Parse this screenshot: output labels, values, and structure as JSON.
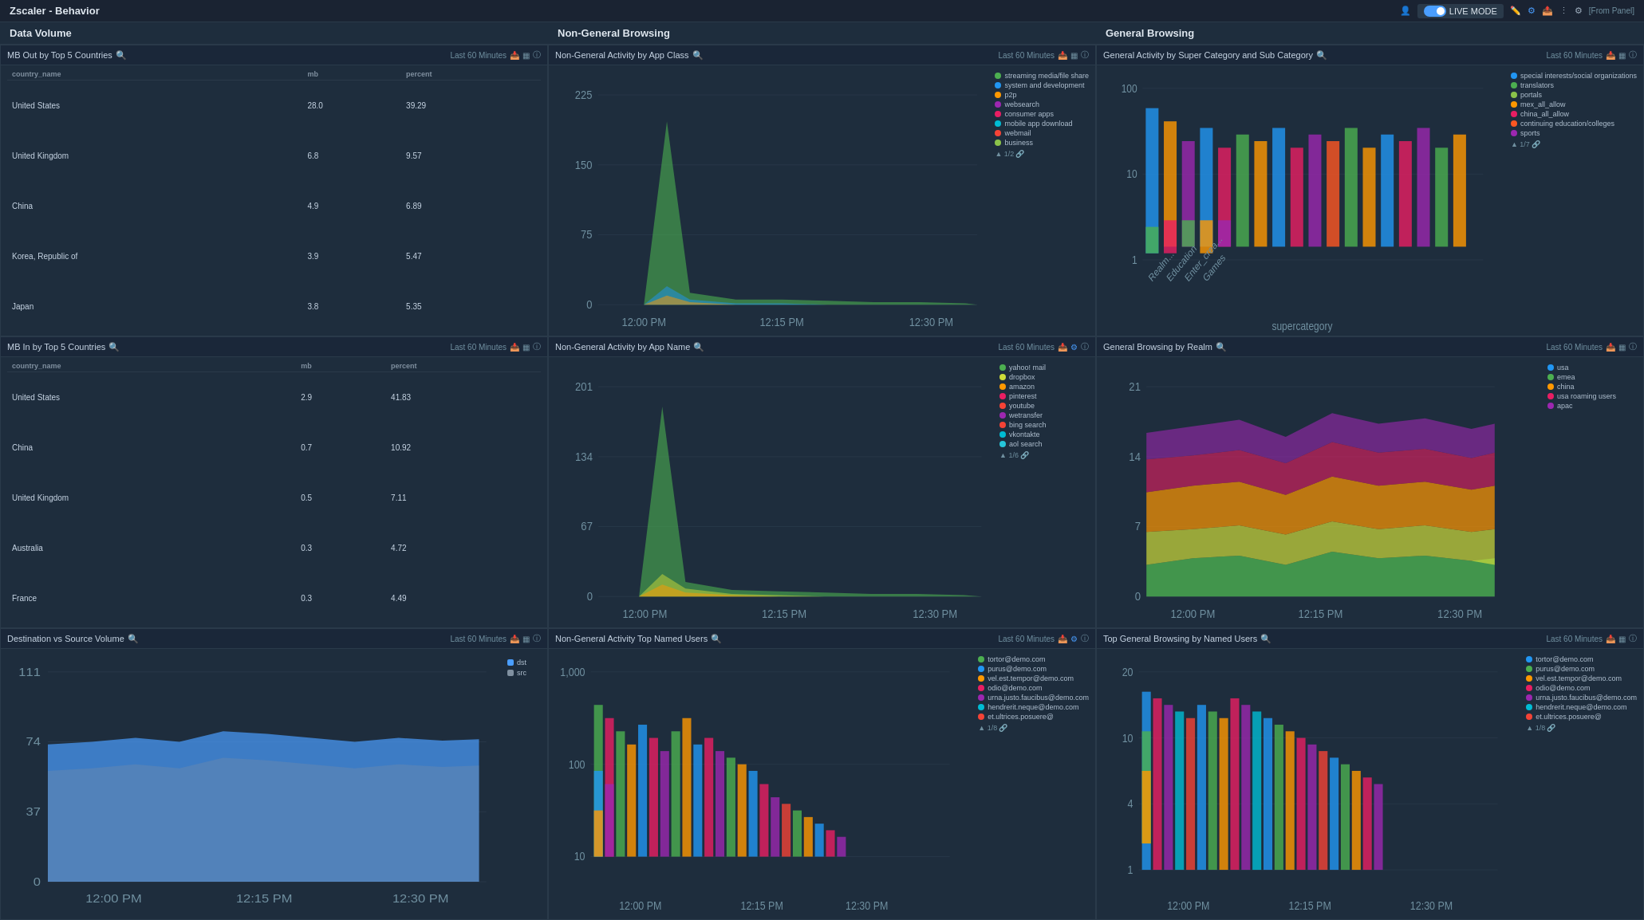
{
  "app": {
    "title": "Zscaler - Behavior",
    "live_mode": "LIVE MODE",
    "from_panel": "[From Panel]"
  },
  "sections": {
    "data_volume": "Data Volume",
    "non_general": "Non-General Browsing",
    "general": "General Browsing"
  },
  "panels": {
    "mb_out": {
      "title": "MB Out by Top 5 Countries",
      "time": "Last 60 Minutes",
      "columns": [
        "country_name",
        "mb",
        "percent"
      ],
      "rows": [
        [
          "United States",
          "28.0",
          "39.29"
        ],
        [
          "United Kingdom",
          "6.8",
          "9.57"
        ],
        [
          "China",
          "4.9",
          "6.89"
        ],
        [
          "Korea, Republic of",
          "3.9",
          "5.47"
        ],
        [
          "Japan",
          "3.8",
          "5.35"
        ]
      ]
    },
    "mb_in": {
      "title": "MB In by Top 5 Countries",
      "time": "Last 60 Minutes",
      "columns": [
        "country_name",
        "mb",
        "percent"
      ],
      "rows": [
        [
          "United States",
          "2.9",
          "41.83"
        ],
        [
          "China",
          "0.7",
          "10.92"
        ],
        [
          "United Kingdom",
          "0.5",
          "7.11"
        ],
        [
          "Australia",
          "0.3",
          "4.72"
        ],
        [
          "France",
          "0.3",
          "4.49"
        ]
      ]
    },
    "dst_src": {
      "title": "Destination vs Source Volume",
      "time": "Last 60 Minutes",
      "y_max": "111",
      "y_mid": "74",
      "y_low": "37",
      "y_zero": "0",
      "legend": [
        "dst",
        "src"
      ],
      "times": [
        "12:00 PM",
        "12:15 PM",
        "12:30 PM"
      ]
    },
    "app_class": {
      "title": "Non-General Activity by App Class",
      "time": "Last 60 Minutes",
      "y_max": "225",
      "y_mid": "150",
      "y_low": "75",
      "y_zero": "0",
      "times": [
        "12:00 PM",
        "12:15 PM",
        "12:30 PM"
      ],
      "legend": [
        {
          "label": "streaming media/file share",
          "color": "#4caf50"
        },
        {
          "label": "system and development",
          "color": "#2196f3"
        },
        {
          "label": "p2p",
          "color": "#ff9800"
        },
        {
          "label": "websearch",
          "color": "#9c27b0"
        },
        {
          "label": "consumer apps",
          "color": "#e91e63"
        },
        {
          "label": "mobile app download",
          "color": "#00bcd4"
        },
        {
          "label": "webmail",
          "color": "#f44336"
        },
        {
          "label": "business",
          "color": "#8bc34a"
        }
      ],
      "page": "1/2"
    },
    "app_name": {
      "title": "Non-General Activity by App Name",
      "time": "Last 60 Minutes",
      "y_max": "201",
      "y_mid": "134",
      "y_low": "67",
      "y_zero": "0",
      "times": [
        "12:00 PM",
        "12:15 PM",
        "12:30 PM"
      ],
      "legend": [
        {
          "label": "yahoo! mail",
          "color": "#4caf50"
        },
        {
          "label": "dropbox",
          "color": "#cddc39"
        },
        {
          "label": "amazon",
          "color": "#ff9800"
        },
        {
          "label": "pinterest",
          "color": "#e91e63"
        },
        {
          "label": "youtube",
          "color": "#f44336"
        },
        {
          "label": "wetransfer",
          "color": "#9c27b0"
        },
        {
          "label": "bing search",
          "color": "#f44336"
        },
        {
          "label": "vkontakte",
          "color": "#00bcd4"
        },
        {
          "label": "aol search",
          "color": "#26c6da"
        }
      ],
      "page": "1/6"
    },
    "top_users_non": {
      "title": "Non-General Activity Top Named Users",
      "time": "Last 60 Minutes",
      "y_max": "1,000",
      "y_mid": "100",
      "y_low": "10",
      "times": [
        "12:00 PM",
        "12:15 PM",
        "12:30 PM"
      ],
      "legend": [
        {
          "label": "tortor@demo.com",
          "color": "#4caf50"
        },
        {
          "label": "purus@demo.com",
          "color": "#2196f3"
        },
        {
          "label": "vel.est.tempor@demo.com",
          "color": "#ff9800"
        },
        {
          "label": "odio@demo.com",
          "color": "#e91e63"
        },
        {
          "label": "urna.justo.faucibus@demo.com",
          "color": "#9c27b0"
        },
        {
          "label": "hendrerit.neque@demo.com",
          "color": "#00bcd4"
        },
        {
          "label": "et.ultrices.posuere@",
          "color": "#f44336"
        }
      ],
      "page": "1/8"
    },
    "general_super": {
      "title": "General Activity by Super Category and Sub Category",
      "time": "Last 60 Minutes",
      "y_max": "100",
      "y_mid": "10",
      "y_low": "1",
      "legend": [
        {
          "label": "special interests/social organizations",
          "color": "#2196f3"
        },
        {
          "label": "translators",
          "color": "#4caf50"
        },
        {
          "label": "portals",
          "color": "#8bc34a"
        },
        {
          "label": "mex_all_allow",
          "color": "#ff9800"
        },
        {
          "label": "china_all_allow",
          "color": "#e91e63"
        },
        {
          "label": "continuing education/colleges",
          "color": "#ff5722"
        },
        {
          "label": "sports",
          "color": "#9c27b0"
        }
      ],
      "page": "1/7",
      "x_label": "supercategory"
    },
    "general_realm": {
      "title": "General Browsing by Realm",
      "time": "Last 60 Minutes",
      "y_max": "21",
      "y_mid": "14",
      "y_low": "7",
      "y_zero": "0",
      "times": [
        "12:00 PM",
        "12:15 PM",
        "12:30 PM"
      ],
      "legend": [
        {
          "label": "usa",
          "color": "#2196f3"
        },
        {
          "label": "emea",
          "color": "#4caf50"
        },
        {
          "label": "china",
          "color": "#ff9800"
        },
        {
          "label": "usa roaming users",
          "color": "#e91e63"
        },
        {
          "label": "apac",
          "color": "#9c27b0"
        }
      ]
    },
    "top_users_gen": {
      "title": "Top General Browsing by Named Users",
      "time": "Last 60 Minutes",
      "y_max": "20",
      "y_mid": "10",
      "y_low": "4",
      "y_bottom": "1",
      "times": [
        "12:00 PM",
        "12:15 PM",
        "12:30 PM"
      ],
      "legend": [
        {
          "label": "tortor@demo.com",
          "color": "#2196f3"
        },
        {
          "label": "purus@demo.com",
          "color": "#4caf50"
        },
        {
          "label": "vel.est.tempor@demo.com",
          "color": "#ff9800"
        },
        {
          "label": "odio@demo.com",
          "color": "#e91e63"
        },
        {
          "label": "urna.justo.faucibus@demo.com",
          "color": "#9c27b0"
        },
        {
          "label": "hendrerit.neque@demo.com",
          "color": "#00bcd4"
        },
        {
          "label": "et.ultrices.posuere@",
          "color": "#f44336"
        }
      ],
      "page": "1/8"
    }
  }
}
